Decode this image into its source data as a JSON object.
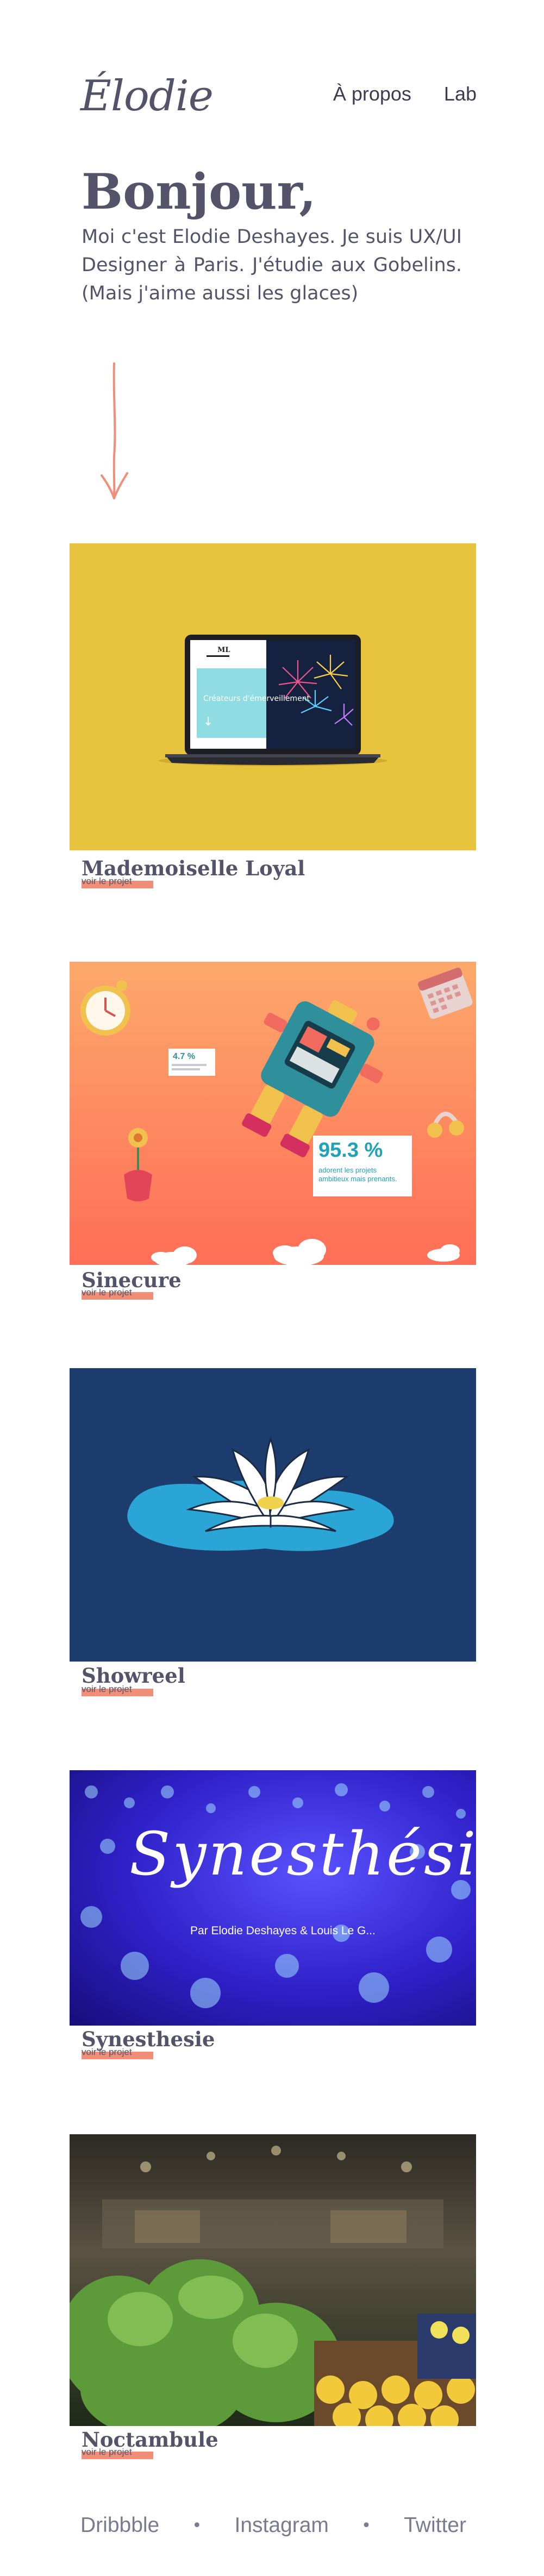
{
  "header": {
    "logo": "Élodie",
    "nav": [
      {
        "label": "À propos"
      },
      {
        "label": "Lab"
      }
    ]
  },
  "hero": {
    "title": "Bonjour,",
    "text": "Moi c'est Elodie Deshayes. Je suis UX/UI Designer à Paris. J'étudie aux Gobelins. (Mais j'aime aussi les glaces)"
  },
  "projects": [
    {
      "title": "Mademoiselle Loyal",
      "link": "voir le projet",
      "bg": "#e8c43e",
      "screen": {
        "brand": "ML",
        "headline": "Créateurs d'émerveillement",
        "arrow": "↓"
      }
    },
    {
      "title": "Sinecure",
      "link": "voir le projet",
      "bg": "#fb7c5c",
      "stats": [
        {
          "value": "4.7 %",
          "caption": ""
        },
        {
          "value": "95.3 %",
          "caption": "adorent les projets ambitieux mais prenants."
        }
      ]
    },
    {
      "title": "Showreel",
      "link": "voir le projet",
      "bg": "#1c3d6e"
    },
    {
      "title": "Synesthesie",
      "link": "voir le projet",
      "bg": "#2f20c8",
      "art": {
        "title": "Synesthésie",
        "credits": "Par Elodie Deshayes & Louis Le G..."
      }
    },
    {
      "title": "Noctambule",
      "link": "voir le projet",
      "bg": "#3c3a2c"
    }
  ],
  "footer": {
    "links": [
      {
        "label": "Dribbble"
      },
      {
        "label": "Instagram"
      },
      {
        "label": "Twitter"
      }
    ],
    "separator": "•"
  },
  "colors": {
    "text": "#54536a",
    "accent": "#f08e77",
    "arrow": "#f08e77"
  }
}
